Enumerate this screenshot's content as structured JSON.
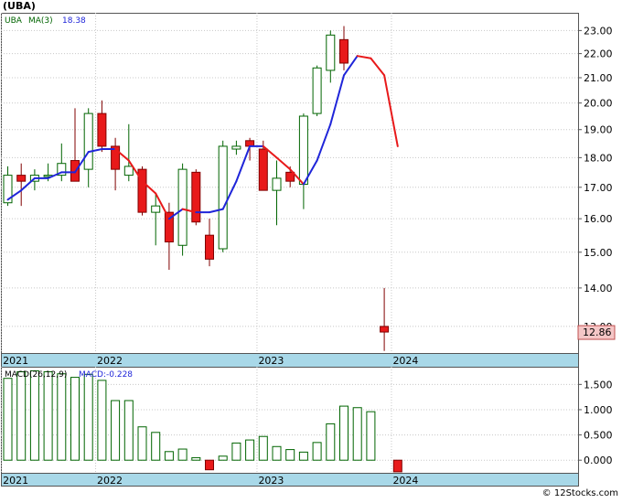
{
  "ticker": "(UBA)",
  "footer": "© 12Stocks.com",
  "colors": {
    "up_body": "#ffffff",
    "up_stroke": "#006400",
    "down_body": "#e8191a",
    "down_stroke": "#800000",
    "ma_up": "#1f25d9",
    "ma_down": "#e8191a",
    "macd_pos": "#ffffff",
    "macd_stroke": "#006400",
    "macd_neg": "#e8191a",
    "axis_band": "#a8d8e8",
    "last_price_box": "#f4c6c6",
    "grid": "#c8c8c8"
  },
  "chart_data": [
    {
      "type": "candlestick",
      "legend": {
        "symbol": "UBA",
        "ma_label": "MA(3)",
        "ma_value": "18.38"
      },
      "x_ticks": [
        {
          "label": "2021",
          "i": 0
        },
        {
          "label": "2022",
          "i": 7
        },
        {
          "label": "2023",
          "i": 19
        },
        {
          "label": "2024",
          "i": 29
        }
      ],
      "y_ticks": [
        13,
        14,
        15,
        16,
        17,
        18,
        19,
        20,
        21,
        22,
        23
      ],
      "y_tick_labels": [
        "13.00",
        "14.00",
        "15.00",
        "16.00",
        "17.00",
        "18.00",
        "19.00",
        "20.00",
        "21.00",
        "22.00",
        "23.00"
      ],
      "ylim": [
        12.35,
        23.8
      ],
      "log_scale": true,
      "last_price_label": "12.86",
      "last_price": 12.86,
      "ohlc": [
        [
          16.5,
          17.7,
          16.4,
          17.4
        ],
        [
          17.4,
          17.8,
          16.4,
          17.2
        ],
        [
          17.2,
          17.6,
          16.9,
          17.4
        ],
        [
          17.4,
          17.8,
          17.2,
          17.4
        ],
        [
          17.4,
          18.5,
          17.2,
          17.8
        ],
        [
          17.9,
          19.8,
          17.3,
          17.2
        ],
        [
          17.6,
          19.8,
          17.0,
          19.6
        ],
        [
          19.6,
          20.1,
          18.2,
          18.4
        ],
        [
          18.4,
          18.7,
          16.9,
          17.6
        ],
        [
          17.4,
          19.2,
          17.2,
          17.7
        ],
        [
          17.6,
          17.7,
          16.1,
          16.2
        ],
        [
          16.2,
          16.8,
          15.2,
          16.4
        ],
        [
          16.2,
          16.5,
          14.5,
          15.3
        ],
        [
          15.2,
          17.8,
          14.9,
          17.6
        ],
        [
          17.5,
          17.6,
          15.8,
          15.9
        ],
        [
          15.5,
          16.0,
          14.6,
          14.8
        ],
        [
          15.1,
          18.6,
          15.0,
          18.4
        ],
        [
          18.3,
          18.6,
          18.1,
          18.4
        ],
        [
          18.6,
          18.7,
          17.9,
          18.4
        ],
        [
          18.3,
          18.6,
          16.9,
          16.9
        ],
        [
          16.9,
          17.9,
          15.8,
          17.3
        ],
        [
          17.5,
          17.7,
          17.0,
          17.2
        ],
        [
          17.1,
          19.6,
          16.3,
          19.5
        ],
        [
          19.6,
          21.5,
          19.5,
          21.4
        ],
        [
          21.3,
          23.0,
          20.8,
          22.8
        ],
        [
          22.6,
          23.2,
          21.3,
          21.6
        ],
        [
          null,
          null,
          null,
          null
        ],
        [
          null,
          null,
          null,
          null
        ],
        [
          13.0,
          14.0,
          12.4,
          12.86
        ]
      ],
      "ma": [
        [
          0,
          16.6
        ],
        [
          1,
          16.9
        ],
        [
          2,
          17.3
        ],
        [
          3,
          17.3
        ],
        [
          4,
          17.5
        ],
        [
          5,
          17.5
        ],
        [
          6,
          18.2
        ],
        [
          7,
          18.3
        ],
        [
          8,
          18.3
        ],
        [
          9,
          17.9
        ],
        [
          10,
          17.2
        ],
        [
          11,
          16.8
        ],
        [
          12,
          16.0
        ],
        [
          13,
          16.3
        ],
        [
          14,
          16.2
        ],
        [
          15,
          16.2
        ],
        [
          16,
          16.3
        ],
        [
          17,
          17.2
        ],
        [
          18,
          18.4
        ],
        [
          19,
          18.4
        ],
        [
          20,
          18.0
        ],
        [
          21,
          17.6
        ],
        [
          22,
          17.1
        ],
        [
          23,
          17.9
        ],
        [
          24,
          19.2
        ],
        [
          25,
          21.1
        ],
        [
          26,
          21.9
        ],
        [
          27,
          21.8
        ],
        [
          28,
          21.1
        ],
        [
          29,
          18.4
        ]
      ]
    },
    {
      "type": "bar",
      "legend": {
        "label": "MACD(26,12,9)",
        "value_label": "MACD:-0.228"
      },
      "y_ticks": [
        0.0,
        0.5,
        1.0,
        1.5
      ],
      "y_tick_labels": [
        "0.000",
        "0.500",
        "1.000",
        "1.500"
      ],
      "ylim": [
        -0.25,
        1.85
      ],
      "values": [
        1.62,
        1.75,
        1.77,
        1.75,
        1.71,
        1.64,
        1.7,
        1.58,
        1.18,
        1.18,
        0.66,
        0.55,
        0.17,
        0.22,
        0.05,
        -0.19,
        0.08,
        0.34,
        0.4,
        0.47,
        0.27,
        0.21,
        0.16,
        0.35,
        0.72,
        1.07,
        1.04,
        0.96,
        null,
        -0.23
      ]
    }
  ]
}
